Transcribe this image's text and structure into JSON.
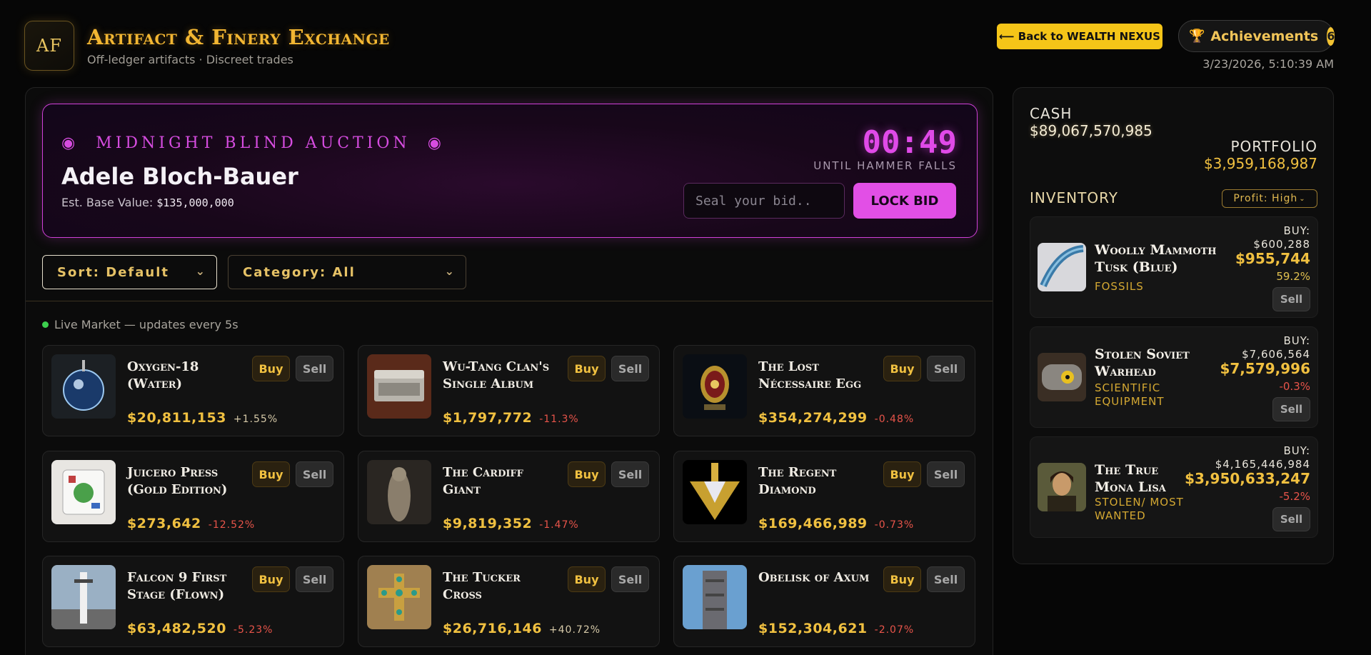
{
  "header": {
    "logo_text": "AF",
    "title": "Artifact & Finery Exchange",
    "subtitle": "Off-ledger artifacts · Discreet trades",
    "back_button": "⟵ Back to WEALTH NEXUS",
    "achievements_label": "Achievements",
    "achievements_count": "6",
    "datetime": "3/23/2026, 5:10:39 AM"
  },
  "auction": {
    "kicker": "👁 MIDNIGHT BLIND AUCTION 👁",
    "kicker_text": "MIDNIGHT BLIND AUCTION",
    "title": "Adele Bloch-Bauer",
    "base_label": "Est. Base Value:",
    "base_value": "$135,000,000",
    "timer": "00:49",
    "until": "UNTIL HAMMER FALLS",
    "bid_placeholder": "Seal your bid..",
    "lock_label": "LOCK BID"
  },
  "filters": {
    "sort": "Sort: Default",
    "category": "Category: All"
  },
  "market": {
    "live_text": "Live Market — updates every 5s",
    "buy_label": "Buy",
    "sell_label": "Sell",
    "items": [
      {
        "name": "Oxygen-18 (Water)",
        "price": "$20,811,153",
        "change": "+1.55%",
        "direction": "up"
      },
      {
        "name": "Wu-Tang Clan's Single Album",
        "price": "$1,797,772",
        "change": "-11.3%",
        "direction": "down"
      },
      {
        "name": "The Lost Nécessaire Egg",
        "price": "$354,274,299",
        "change": "-0.48%",
        "direction": "down"
      },
      {
        "name": "Juicero Press (Gold Edition)",
        "price": "$273,642",
        "change": "-12.52%",
        "direction": "down"
      },
      {
        "name": "The Cardiff Giant",
        "price": "$9,819,352",
        "change": "-1.47%",
        "direction": "down"
      },
      {
        "name": "The Regent Diamond",
        "price": "$169,466,989",
        "change": "-0.73%",
        "direction": "down"
      },
      {
        "name": "Falcon 9 First Stage (Flown)",
        "price": "$63,482,520",
        "change": "-5.23%",
        "direction": "down"
      },
      {
        "name": "The Tucker Cross",
        "price": "$26,716,146",
        "change": "+40.72%",
        "direction": "up"
      },
      {
        "name": "Obelisk of Axum",
        "price": "$152,304,621",
        "change": "-2.07%",
        "direction": "down"
      }
    ]
  },
  "portfolio": {
    "cash_label": "CASH",
    "cash_value": "$89,067,570,985",
    "portfolio_label": "PORTFOLIO",
    "portfolio_value": "$3,959,168,987",
    "inventory_label": "INVENTORY",
    "profit_filter": "Profit: High",
    "buy_label": "BUY:",
    "sell_label": "Sell",
    "inventory": [
      {
        "name": "Woolly Mammoth Tusk (Blue)",
        "category": "FOSSILS",
        "buy": "$600,288",
        "current": "$955,744",
        "pct": "59.2%",
        "direction": "up"
      },
      {
        "name": "Stolen Soviet Warhead",
        "category": "SCIENTIFIC EQUIPMENT",
        "buy": "$7,606,564",
        "current": "$7,579,996",
        "pct": "-0.3%",
        "direction": "down"
      },
      {
        "name": "The True Mona Lisa",
        "category": "STOLEN/ MOST WANTED",
        "buy": "$4,165,446,984",
        "current": "$3,950,633,247",
        "pct": "-5.2%",
        "direction": "down"
      }
    ]
  },
  "colors": {
    "gold": "#f0c040",
    "magenta": "#e24fe6",
    "loss": "#e8544a",
    "live": "#3ccf4e"
  }
}
